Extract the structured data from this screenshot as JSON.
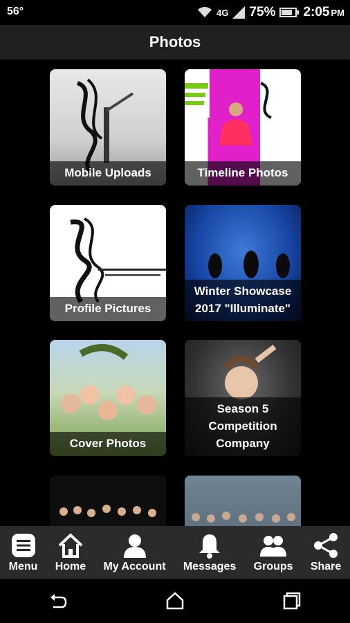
{
  "status": {
    "temp": "56°",
    "network": "4G",
    "battery": "75%",
    "time": "2:05",
    "ampm": "PM"
  },
  "header": {
    "title": "Photos"
  },
  "albums": [
    {
      "label": "Mobile Uploads"
    },
    {
      "label": "Timeline Photos"
    },
    {
      "label": "Profile Pictures"
    },
    {
      "label": "Winter Showcase 2017 \"Illuminate\""
    },
    {
      "label": "Cover Photos"
    },
    {
      "label": "Season 5 Competition Company"
    }
  ],
  "nav": [
    {
      "label": "Menu",
      "icon": "menu-icon"
    },
    {
      "label": "Home",
      "icon": "home-icon"
    },
    {
      "label": "My Account",
      "icon": "account-icon"
    },
    {
      "label": "Messages",
      "icon": "bell-icon"
    },
    {
      "label": "Groups",
      "icon": "groups-icon"
    },
    {
      "label": "Share",
      "icon": "share-icon"
    }
  ]
}
